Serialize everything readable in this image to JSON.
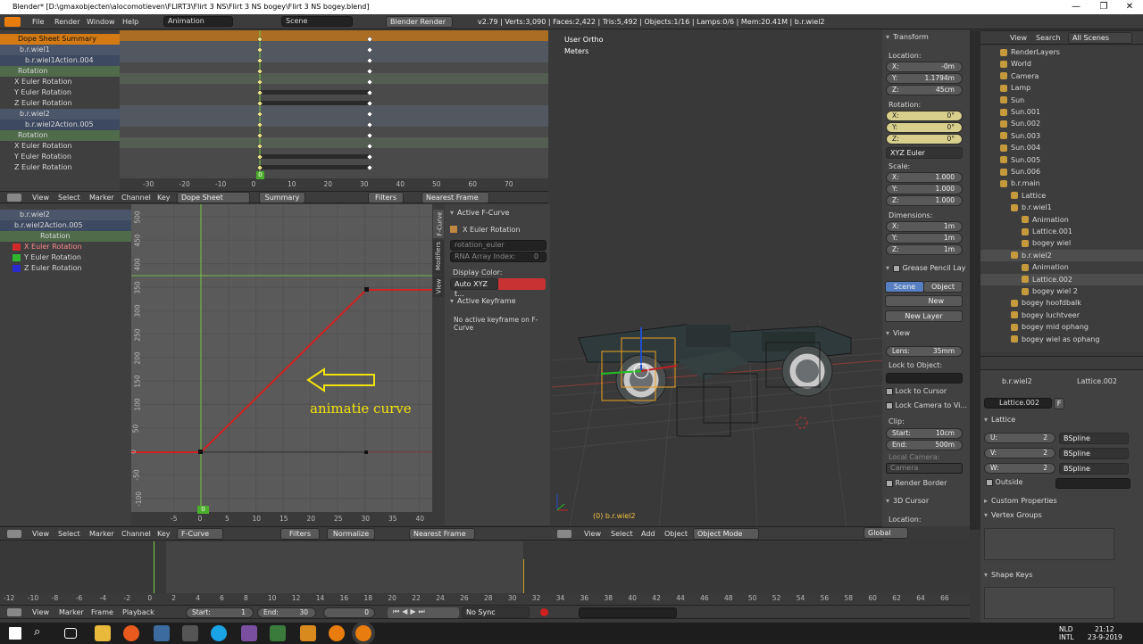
{
  "window": {
    "title": "Blender* [D:\\gmaxobjecten\\alocomotieven\\FLIRT3\\Flirt 3 NS\\Flirt 3 NS bogey\\Flirt 3 NS bogey.blend]",
    "minimize": "—",
    "maximize": "❐",
    "close": "✕"
  },
  "topbar": {
    "menus": [
      "File",
      "Render",
      "Window",
      "Help"
    ],
    "screen_layout": "Animation",
    "scene": "Scene",
    "engine": "Blender Render",
    "stats": "v2.79 | Verts:3,090 | Faces:2,422 | Tris:5,492 | Objects:1/16 | Lamps:0/6 | Mem:20.41M | b.r.wiel2"
  },
  "dopesheet": {
    "channels": [
      {
        "label": "Dope Sheet Summary",
        "kind": "summary"
      },
      {
        "label": "b.r.wiel1",
        "kind": "object"
      },
      {
        "label": "b.r.wiel1Action.004",
        "kind": "action"
      },
      {
        "label": "Rotation",
        "kind": "group"
      },
      {
        "label": "X Euler Rotation",
        "kind": "curve"
      },
      {
        "label": "Y Euler Rotation",
        "kind": "curve"
      },
      {
        "label": "Z Euler Rotation",
        "kind": "curve"
      },
      {
        "label": "b.r.wiel2",
        "kind": "object"
      },
      {
        "label": "b.r.wiel2Action.005",
        "kind": "action"
      },
      {
        "label": "Rotation",
        "kind": "group"
      },
      {
        "label": "X Euler Rotation",
        "kind": "curve"
      },
      {
        "label": "Y Euler Rotation",
        "kind": "curve"
      },
      {
        "label": "Z Euler Rotation",
        "kind": "curve"
      }
    ],
    "ruler": [
      "-30",
      "-20",
      "-10",
      "0",
      "10",
      "20",
      "30",
      "40",
      "50",
      "60",
      "70"
    ],
    "current_frame": "0",
    "header": {
      "menus": [
        "View",
        "Select",
        "Marker",
        "Channel",
        "Key"
      ],
      "mode": "Dope Sheet",
      "summary": "Summary",
      "filters": "Filters",
      "snap": "Nearest Frame"
    }
  },
  "graph": {
    "channels": [
      "b.r.wiel2",
      "b.r.wiel2Action.005",
      "Rotation",
      "X Euler Rotation",
      "Y Euler Rotation",
      "Z Euler Rotation"
    ],
    "yticks": [
      "500",
      "450",
      "400",
      "350",
      "300",
      "250",
      "200",
      "150",
      "100",
      "50",
      "0",
      "-50",
      "-100"
    ],
    "xticks": [
      "-5",
      "0",
      "5",
      "10",
      "15",
      "20",
      "25",
      "30",
      "35",
      "40"
    ],
    "current_frame": "0",
    "annotation": "animatie curve",
    "tabs": [
      "F-Curve",
      "Modifiers",
      "View"
    ],
    "header": {
      "menus": [
        "View",
        "Select",
        "Marker",
        "Channel",
        "Key"
      ],
      "mode": "F-Curve",
      "filters": "Filters",
      "normalize": "Normalize",
      "snap": "Nearest Frame"
    }
  },
  "fcurve_panel": {
    "active_fcurve": "Active F-Curve",
    "curve_name": "X Euler Rotation",
    "rna_path": "rotation_euler",
    "rna_index_label": "RNA Array Index:",
    "rna_index": "0",
    "display_color_label": "Display Color:",
    "display_color_mode": "Auto XYZ t...",
    "curve_color": "#c83232",
    "active_keyframe": "Active Keyframe",
    "no_keyframe": "No active keyframe on F-Curve"
  },
  "viewport": {
    "view_name": "User Ortho",
    "units": "Meters",
    "object_label": "(0) b.r.wiel2",
    "header": {
      "menus": [
        "View",
        "Select",
        "Add",
        "Object"
      ],
      "mode": "Object Mode",
      "orientation": "Global"
    }
  },
  "properties": {
    "transform": "Transform",
    "location_label": "Location:",
    "location": [
      {
        "axis": "X:",
        "value": "-0m"
      },
      {
        "axis": "Y:",
        "value": "1.1794m"
      },
      {
        "axis": "Z:",
        "value": "45cm"
      }
    ],
    "rotation_label": "Rotation:",
    "rotation": [
      {
        "axis": "X:",
        "value": "0°"
      },
      {
        "axis": "Y:",
        "value": "0°"
      },
      {
        "axis": "Z:",
        "value": "0°"
      }
    ],
    "rotation_mode": "XYZ Euler",
    "scale_label": "Scale:",
    "scale": [
      {
        "axis": "X:",
        "value": "1.000"
      },
      {
        "axis": "Y:",
        "value": "1.000"
      },
      {
        "axis": "Z:",
        "value": "1.000"
      }
    ],
    "dimensions_label": "Dimensions:",
    "dimensions": [
      {
        "axis": "X:",
        "value": "1m"
      },
      {
        "axis": "Y:",
        "value": "1m"
      },
      {
        "axis": "Z:",
        "value": "1m"
      }
    ],
    "grease_pencil": "Grease Pencil Lay",
    "gp_scene": "Scene",
    "gp_object": "Object",
    "gp_new": "New",
    "gp_new_layer": "New Layer",
    "view": "View",
    "lens_label": "Lens:",
    "lens": "35mm",
    "lock_label": "Lock to Object:",
    "lock_cursor": "Lock to Cursor",
    "lock_camera": "Lock Camera to Vi...",
    "clip_label": "Clip:",
    "clip_start_label": "Start:",
    "clip_start": "10cm",
    "clip_end_label": "End:",
    "clip_end": "500m",
    "local_camera": "Local Camera:",
    "camera": "Camera",
    "render_border": "Render Border",
    "cursor3d": "3D Cursor",
    "cursor_location": "Location:"
  },
  "outliner": {
    "menus": [
      "View",
      "Search"
    ],
    "filter": "All Scenes",
    "items": [
      {
        "label": "RenderLayers",
        "indent": 1
      },
      {
        "label": "World",
        "indent": 1
      },
      {
        "label": "Camera",
        "indent": 1
      },
      {
        "label": "Lamp",
        "indent": 1
      },
      {
        "label": "Sun",
        "indent": 1
      },
      {
        "label": "Sun.001",
        "indent": 1
      },
      {
        "label": "Sun.002",
        "indent": 1
      },
      {
        "label": "Sun.003",
        "indent": 1
      },
      {
        "label": "Sun.004",
        "indent": 1
      },
      {
        "label": "Sun.005",
        "indent": 1
      },
      {
        "label": "Sun.006",
        "indent": 1
      },
      {
        "label": "b.r.main",
        "indent": 1
      },
      {
        "label": "Lattice",
        "indent": 2
      },
      {
        "label": "b.r.wiel1",
        "indent": 2
      },
      {
        "label": "Animation",
        "indent": 3
      },
      {
        "label": "Lattice.001",
        "indent": 3
      },
      {
        "label": "bogey wiel",
        "indent": 3
      },
      {
        "label": "b.r.wiel2",
        "indent": 2
      },
      {
        "label": "Animation",
        "indent": 3
      },
      {
        "label": "Lattice.002",
        "indent": 3
      },
      {
        "label": "bogey wiel 2",
        "indent": 3
      },
      {
        "label": "bogey hoofdbalk",
        "indent": 2
      },
      {
        "label": "bogey luchtveer",
        "indent": 2
      },
      {
        "label": "bogey mid ophang",
        "indent": 2
      },
      {
        "label": "bogey wiel as ophang",
        "indent": 2
      }
    ]
  },
  "lattice_props": {
    "breadcrumb_obj": "b.r.wiel2",
    "breadcrumb_data": "Lattice.002",
    "datablock": "Lattice.002",
    "fake_user": "F",
    "lattice_panel": "Lattice",
    "u_label": "U:",
    "u": "2",
    "u_interp": "BSpline",
    "v_label": "V:",
    "v": "2",
    "v_interp": "BSpline",
    "w_label": "W:",
    "w": "2",
    "w_interp": "BSpline",
    "outside": "Outside",
    "custom_props": "Custom Properties",
    "vertex_groups": "Vertex Groups",
    "shape_keys": "Shape Keys"
  },
  "timeline": {
    "ruler": [
      "-12",
      "-10",
      "-8",
      "-6",
      "-4",
      "-2",
      "0",
      "2",
      "4",
      "6",
      "8",
      "10",
      "12",
      "14",
      "16",
      "18",
      "20",
      "22",
      "24",
      "26",
      "28",
      "30",
      "32",
      "34",
      "36",
      "38",
      "40",
      "42",
      "44",
      "46",
      "48",
      "50",
      "52",
      "54",
      "56",
      "58",
      "60",
      "62",
      "64",
      "66"
    ],
    "menus": [
      "View",
      "Marker",
      "Frame",
      "Playback"
    ],
    "start_label": "Start:",
    "start": "1",
    "end_label": "End:",
    "end": "30",
    "current": "0",
    "sync": "No Sync"
  },
  "taskbar": {
    "lang": "NLD",
    "layout": "INTL",
    "time": "21:12",
    "date": "23-9-2019"
  }
}
